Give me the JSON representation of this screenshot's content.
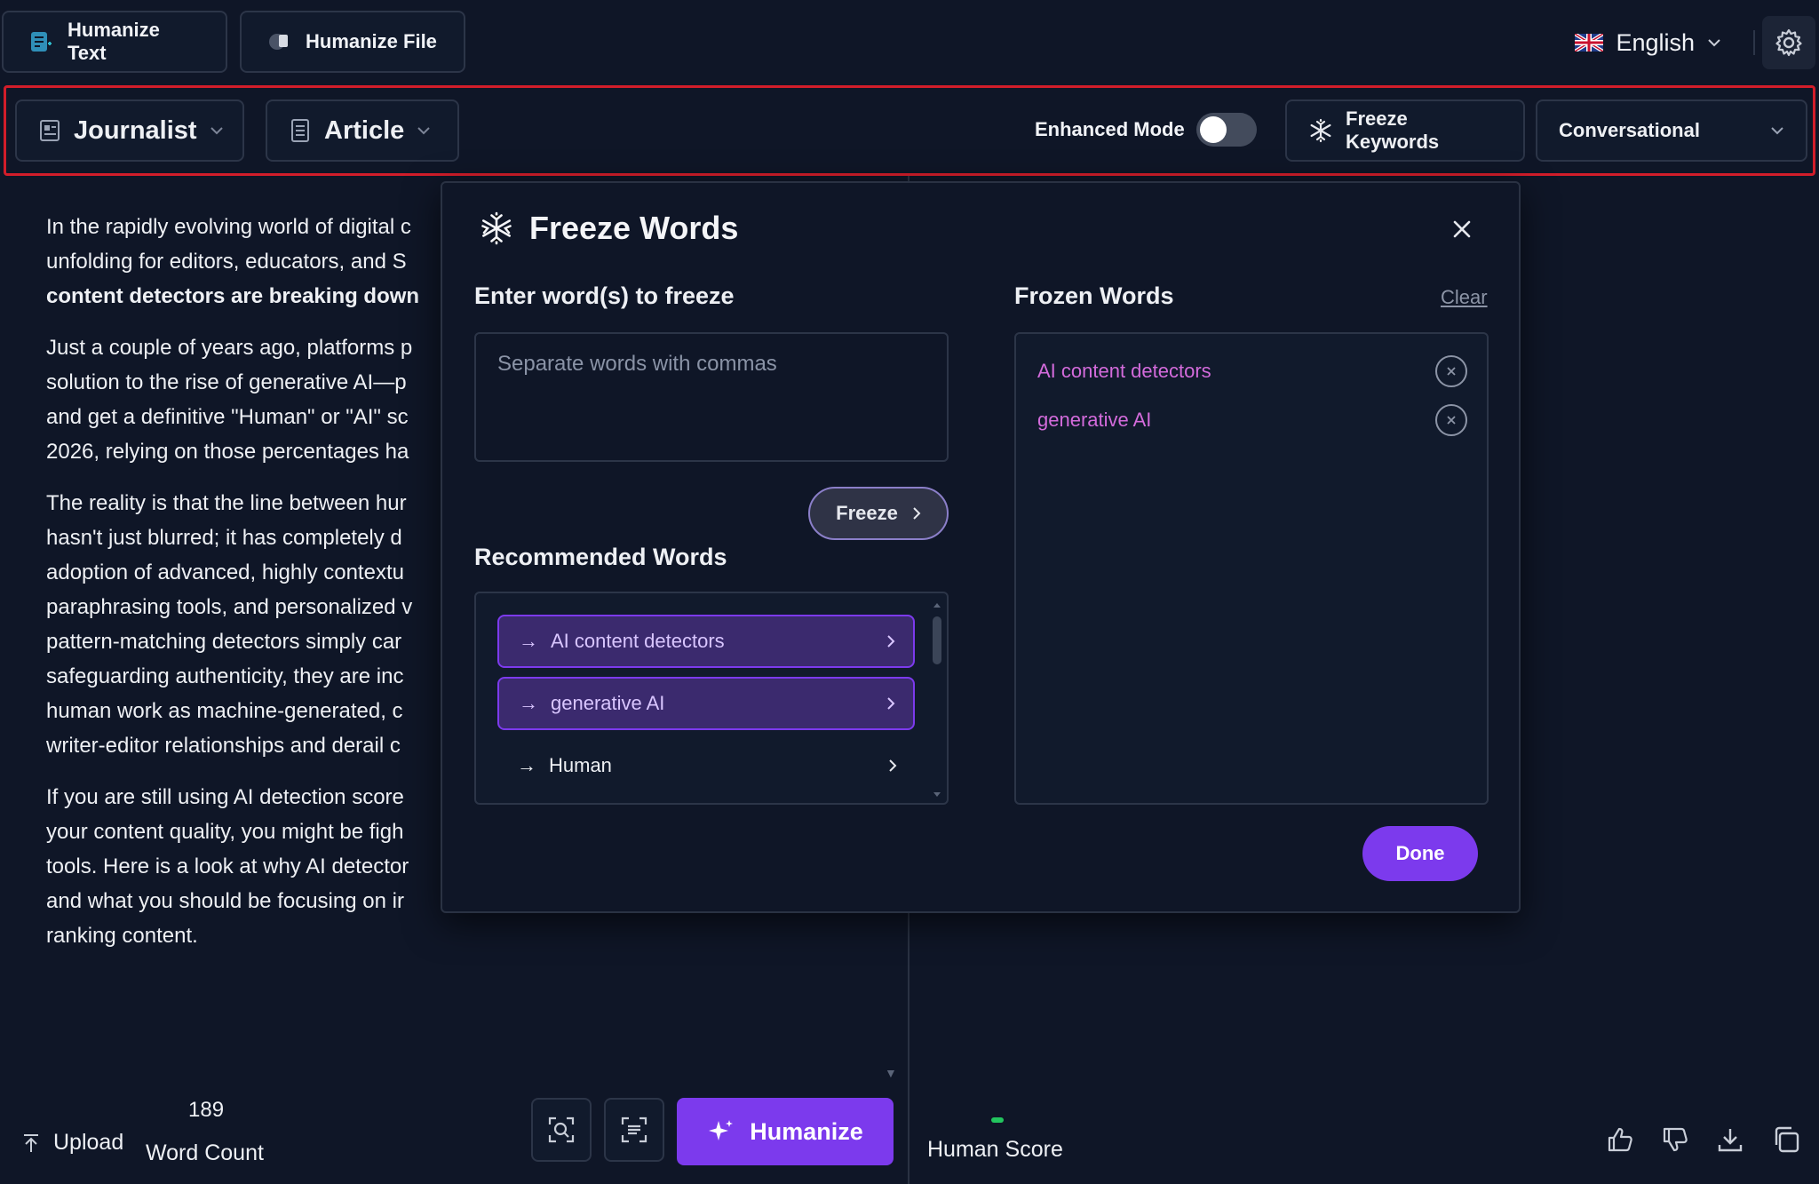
{
  "top_tabs": [
    {
      "label": "Humanize Text"
    },
    {
      "label": "Humanize File"
    }
  ],
  "language": {
    "label": "English"
  },
  "toolbar": {
    "persona": "Journalist",
    "content_type": "Article",
    "enhanced_mode_label": "Enhanced Mode",
    "enhanced_mode_on": false,
    "freeze_keywords_label": "Freeze Keywords",
    "tone": "Conversational"
  },
  "editor": {
    "paragraphs": [
      {
        "lines": [
          "In the rapidly evolving world of digital c",
          "unfolding for editors, educators, and S"
        ],
        "bold_line": "content detectors are breaking down"
      },
      {
        "lines": [
          "Just a couple of years ago, platforms p",
          "solution to the rise of generative AI—p",
          "and get a definitive \"Human\" or \"AI\" sc",
          "2026, relying on those percentages ha"
        ]
      },
      {
        "lines": [
          "The reality is that the line between hur",
          "hasn't just blurred; it has completely d",
          "adoption of advanced, highly contextu",
          "paraphrasing tools, and personalized v",
          "pattern-matching detectors simply car",
          "safeguarding authenticity, they are inc",
          "human work as machine-generated, c",
          "writer-editor relationships and derail c"
        ]
      },
      {
        "lines": [
          "If you are still using AI detection score",
          "your content quality, you might be figh",
          "tools. Here is a look at why AI detector",
          "and what you should be focusing on ir",
          "ranking content."
        ]
      }
    ],
    "upload_label": "Upload",
    "word_count_value": "189",
    "word_count_label": "Word Count",
    "humanize_label": "Humanize"
  },
  "output": {
    "human_score_label": "Human Score"
  },
  "modal": {
    "title": "Freeze Words",
    "input_heading": "Enter word(s) to freeze",
    "input_placeholder": "Separate words with commas",
    "input_value": "",
    "freeze_button": "Freeze",
    "recommended_heading": "Recommended Words",
    "recommended": [
      {
        "arrow": "→",
        "label": "AI content detectors",
        "selected": true
      },
      {
        "arrow": "→",
        "label": "generative AI",
        "selected": true
      },
      {
        "arrow": "→",
        "label": "Human",
        "selected": false
      }
    ],
    "frozen_heading": "Frozen Words",
    "clear_label": "Clear",
    "frozen": [
      {
        "label": "AI content detectors"
      },
      {
        "label": "generative AI"
      }
    ],
    "done_button": "Done"
  },
  "colors": {
    "accent": "#7c3aed",
    "frozen_text": "#d36bdb",
    "highlight_border": "#d21d2a",
    "background": "#0f1627"
  }
}
